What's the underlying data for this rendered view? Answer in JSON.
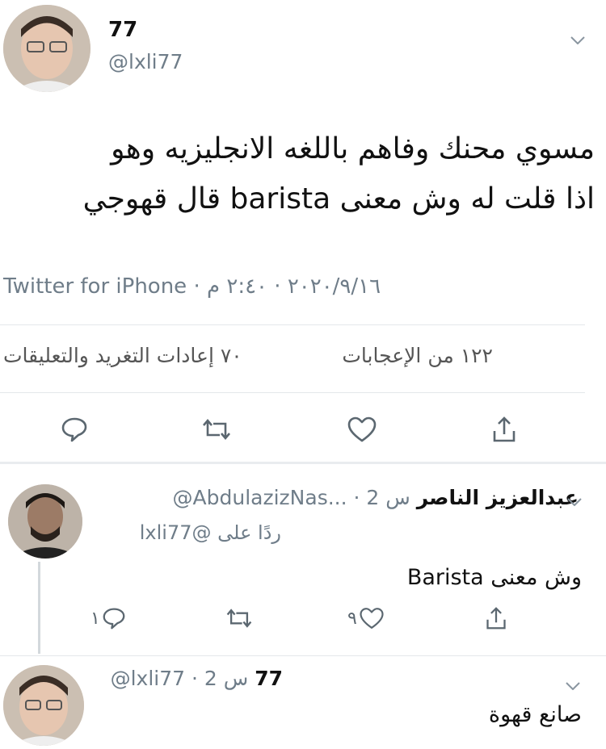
{
  "tweet": {
    "author_name": "77",
    "author_handle": "@lxli77",
    "text_line1": "مسوي محنك وفاهم باللغه الانجليزيه وهو",
    "text_line2": "اذا قلت له وش معنى barista قال قهوجي",
    "meta": "Twitter for iPhone · ٢٠٢٠/٩/١٦ · ٢:٤٠ م",
    "stats_retweets": "٧٠ إعادات التغريد والتعليقات",
    "stats_likes": "١٢٢ من الإعجابات"
  },
  "reply1": {
    "name": "عبدالعزيز الناصر",
    "handle_time": "@AbdulazizNas... · 2 س",
    "replying_to": "ردًا على @lxli77",
    "text": "وش معنى Barista",
    "reply_count": "١",
    "like_count": "٩"
  },
  "reply2": {
    "name": "77",
    "handle_time": "@lxli77 · 2 س",
    "text": "صانع قهوة"
  },
  "icons": {
    "reply": "reply-icon",
    "retweet": "retweet-icon",
    "like": "heart-icon",
    "share": "share-icon",
    "more": "chevron-down-icon"
  },
  "colors": {
    "text": "#111111",
    "muted": "#6f7d89",
    "divider": "#e4e7ea",
    "icon": "#5b6770"
  }
}
